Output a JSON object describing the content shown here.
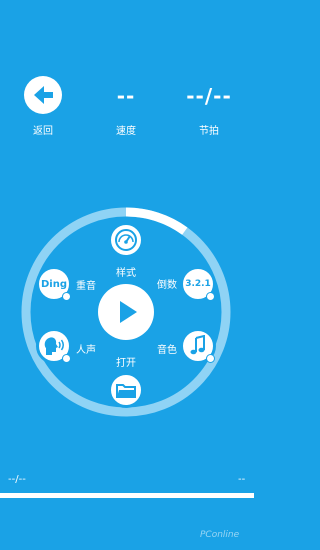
{
  "header": {
    "back_label": "返回",
    "speed_label": "速度",
    "speed_value": "--",
    "beat_label": "节拍",
    "beat_value": "--/--"
  },
  "dial": {
    "style_label": "样式",
    "countdown_label": "倒数",
    "countdown_badge": "3.2.1",
    "tone_label": "音色",
    "open_label": "打开",
    "voice_label": "人声",
    "accent_label": "重音",
    "accent_badge": "Ding",
    "progress": 0.1
  },
  "footer": {
    "left_value": "--/--",
    "right_value": "--"
  },
  "watermark": "PConline"
}
